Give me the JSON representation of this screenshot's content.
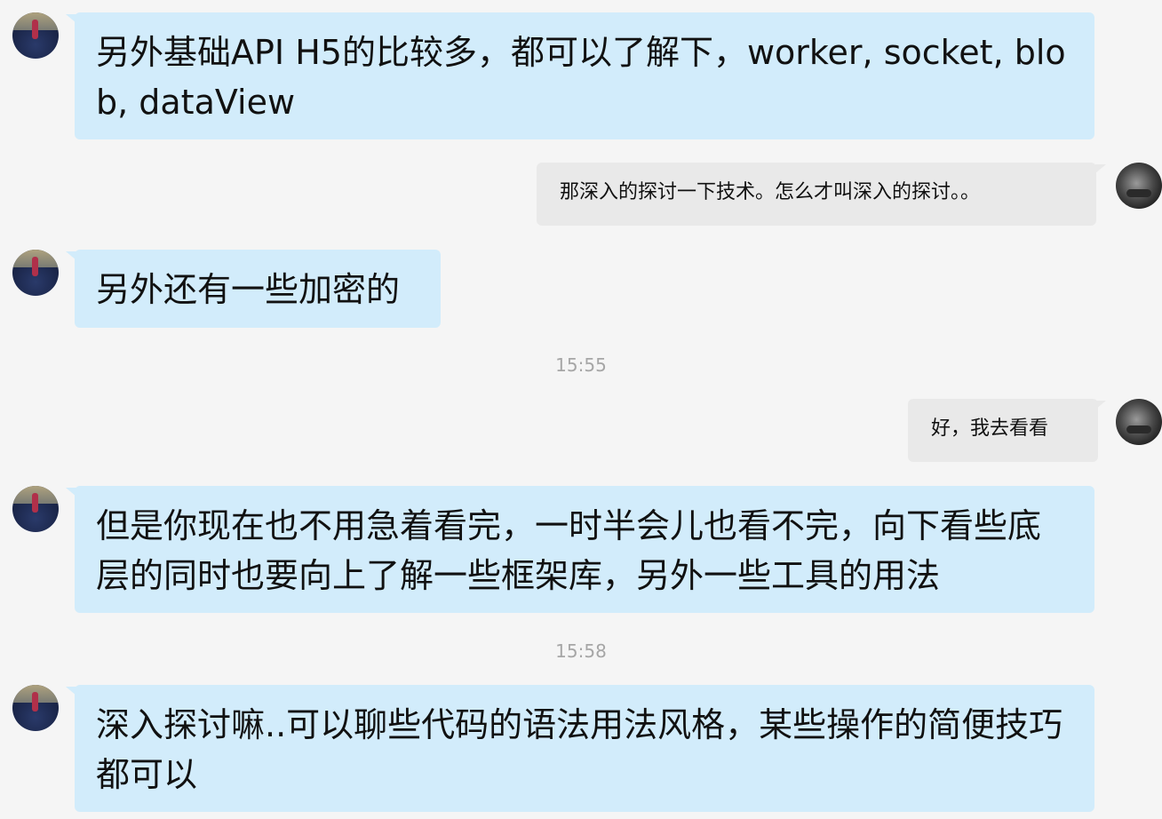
{
  "messages": [
    {
      "sender": "them",
      "text": "另外基础API H5的比较多，都可以了解下，worker, socket, blob, dataView"
    },
    {
      "sender": "me",
      "text": "那深入的探讨一下技术。怎么才叫深入的探讨。。"
    },
    {
      "sender": "them",
      "text": "另外还有一些加密的"
    },
    {
      "type": "timestamp",
      "text": "15:55"
    },
    {
      "sender": "me",
      "text": "好，我去看看"
    },
    {
      "sender": "them",
      "text": "但是你现在也不用急着看完，一时半会儿也看不完，向下看些底层的同时也要向上了解一些框架库，另外一些工具的用法"
    },
    {
      "type": "timestamp",
      "text": "15:58"
    },
    {
      "sender": "them",
      "text": "深入探讨嘛..可以聊些代码的语法用法风格，某些操作的简便技巧都可以"
    }
  ],
  "colors": {
    "background": "#f5f5f5",
    "incoming_bubble": "#d2ecfb",
    "outgoing_bubble": "#e9e9e9",
    "timestamp_text": "#a6a6a6"
  }
}
